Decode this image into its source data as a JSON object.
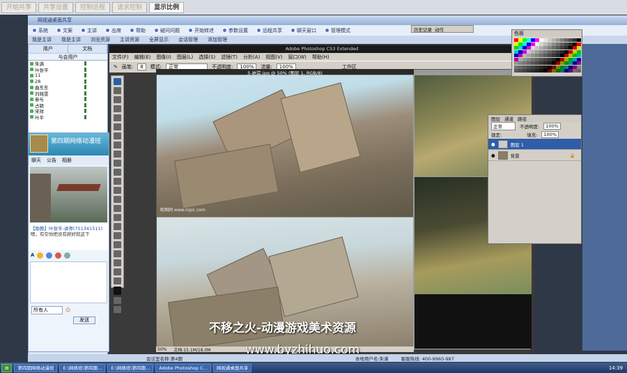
{
  "top_buttons": [
    {
      "label": "开始共享",
      "active": false
    },
    {
      "label": "共享设置",
      "active": false
    },
    {
      "label": "控制远程",
      "active": false
    },
    {
      "label": "请求控制",
      "active": false
    },
    {
      "label": "显示比例",
      "active": true
    }
  ],
  "main_window": {
    "title": "网视通桌面共享",
    "toolbar": [
      "系统",
      "文案",
      "主讲",
      "出席",
      "帮助",
      "疑问问题",
      "开始转述",
      "参数设置",
      "远程共享",
      "聊天窗口",
      "管理模式"
    ],
    "subbar": [
      "我是主讲",
      "我是主讲",
      "浏览资源",
      "主讲资源",
      "全屏显示",
      "会话管理",
      "添加管理"
    ],
    "history_tabs": [
      "历史记录",
      "动作"
    ]
  },
  "user_panel": {
    "tabs": [
      "用户",
      "文档"
    ],
    "group": "与会用户",
    "users": [
      "朱满",
      "叶张平",
      "11",
      "28",
      "曲东东",
      "刘晓雯",
      "参与",
      "占颖",
      "宋祥",
      "叶平"
    ]
  },
  "chat": {
    "title": "第四期网络动漫班",
    "tabs": [
      "聊天",
      "公告",
      "相册"
    ],
    "message_sender": "【助教】叶张平-讲师(751341511)",
    "message_text": "嗯，有空你把没有顾好就这下",
    "recipient": "所有人",
    "send_label": "发送"
  },
  "photoshop": {
    "title": "Adobe Photoshop CS3 Extended",
    "menu": [
      "文件(F)",
      "编辑(E)",
      "图像(I)",
      "图层(L)",
      "选择(S)",
      "滤镜(T)",
      "分析(A)",
      "视图(V)",
      "窗口(W)",
      "帮助(H)"
    ],
    "options": {
      "brush_label": "画笔:",
      "brush_size": "8",
      "mode_label": "模式:",
      "mode_value": "正常",
      "opacity_label": "不透明度:",
      "opacity_value": "100%",
      "flow_label": "流量:",
      "flow_value": "100%",
      "workspace": "工作区"
    },
    "doc_title": "5-岩岸.jpg @ 50% (图层 1, RGB/8)",
    "zoom": "50%",
    "doc_info": "文档:15.1M/18.0M",
    "watermark": "昵图网 www.nipic.com"
  },
  "swatches": {
    "title": "色板"
  },
  "layers_panel": {
    "tabs": [
      "图层",
      "通道",
      "路径"
    ],
    "blend": "正常",
    "opacity_label": "不透明度:",
    "opacity_value": "100%",
    "lock_label": "锁定:",
    "fill_label": "填充:",
    "fill_value": "100%",
    "layers": [
      {
        "name": "图层 1",
        "selected": true
      },
      {
        "name": "背景",
        "selected": false
      }
    ]
  },
  "overlay": {
    "title": "不移之火-动漫游戏美术资源",
    "url": "www.byzhihuo.com"
  },
  "status_bottom": {
    "left": "会议室名称:第4期",
    "middle": "本地用户名:朱满",
    "right": "客服热线: 400-9960-987"
  },
  "taskbar": {
    "items": [
      "第四期网络动漫班",
      "E:\\网络班\\第四期...",
      "E:\\网络班\\第四期...",
      "Adobe Photoshop C...",
      "网视通桌面共享"
    ],
    "clock": "14:39"
  },
  "swatch_colors": [
    "#ff0000",
    "#ffff00",
    "#00ff00",
    "#00ffff",
    "#0000ff",
    "#ff00ff",
    "#ffffff",
    "#e6e6e6",
    "#cccccc",
    "#b3b3b3",
    "#999999",
    "#808080",
    "#666666",
    "#4d4d4d",
    "#333333",
    "#000000"
  ]
}
